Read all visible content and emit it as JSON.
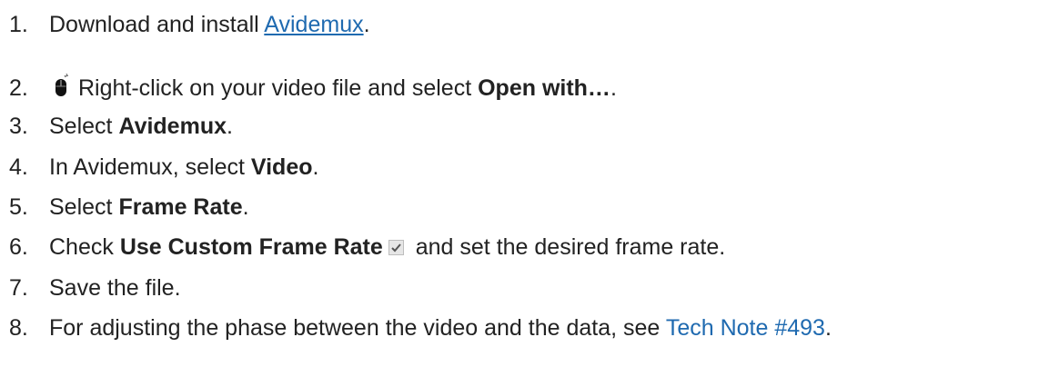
{
  "steps": [
    {
      "number": "1.",
      "before": "Download and install ",
      "link": "Avidemux",
      "after": "."
    },
    {
      "number": "2.",
      "text": "Right-click on your video file and select ",
      "bold": "Open with…",
      "after": ".",
      "icon": "mouse-icon"
    },
    {
      "number": "3.",
      "text": "Select ",
      "bold": "Avidemux",
      "after": "."
    },
    {
      "number": "4.",
      "text": "In Avidemux, select ",
      "bold": "Video",
      "after": "."
    },
    {
      "number": "5.",
      "text": "Select ",
      "bold": "Frame Rate",
      "after": "."
    },
    {
      "number": "6.",
      "text": "Check ",
      "bold": "Use Custom Frame Rate",
      "after": " and set the desired frame rate.",
      "icon": "checkbox-checked-icon"
    },
    {
      "number": "7.",
      "text": "Save the file."
    },
    {
      "number": "8.",
      "text": "For adjusting the phase between the video and the data, see ",
      "link": "Tech Note #493",
      "after": "."
    }
  ],
  "colors": {
    "link": "#1f6ab0",
    "text": "#222222",
    "background": "#ffffff"
  }
}
